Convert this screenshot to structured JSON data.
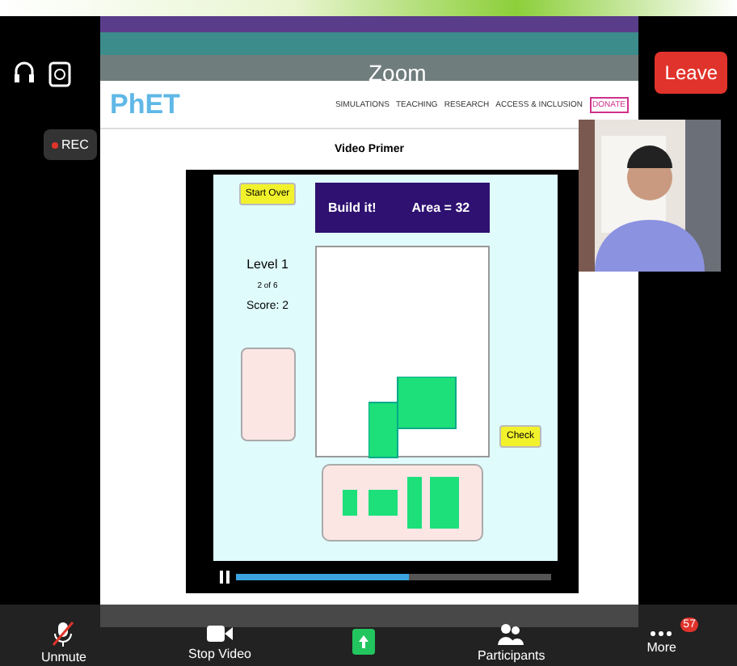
{
  "meeting": {
    "title": "Zoom",
    "leave": "Leave",
    "recording": "REC"
  },
  "browser": {
    "logo": "PhET",
    "nav": [
      "SIMULATIONS",
      "TEACHING",
      "RESEARCH",
      "ACCESS & INCLUSION"
    ],
    "donate": "DONATE",
    "page_title": "Video Primer"
  },
  "game": {
    "start_over": "Start Over",
    "heading": "Build it!",
    "area": "Area = 32",
    "level": "Level 1",
    "progress": "2 of 6",
    "score": "Score: 2",
    "check": "Check"
  },
  "player": {
    "playing": true,
    "level": 0.55
  },
  "toolbar": [
    {
      "kind": "mic",
      "label": "Unmute",
      "muted": true
    },
    {
      "kind": "video",
      "label": "Stop Video"
    },
    {
      "kind": "share"
    },
    {
      "kind": "people",
      "label": "Participants"
    },
    {
      "kind": "more",
      "label": "More",
      "badge": "57"
    }
  ]
}
